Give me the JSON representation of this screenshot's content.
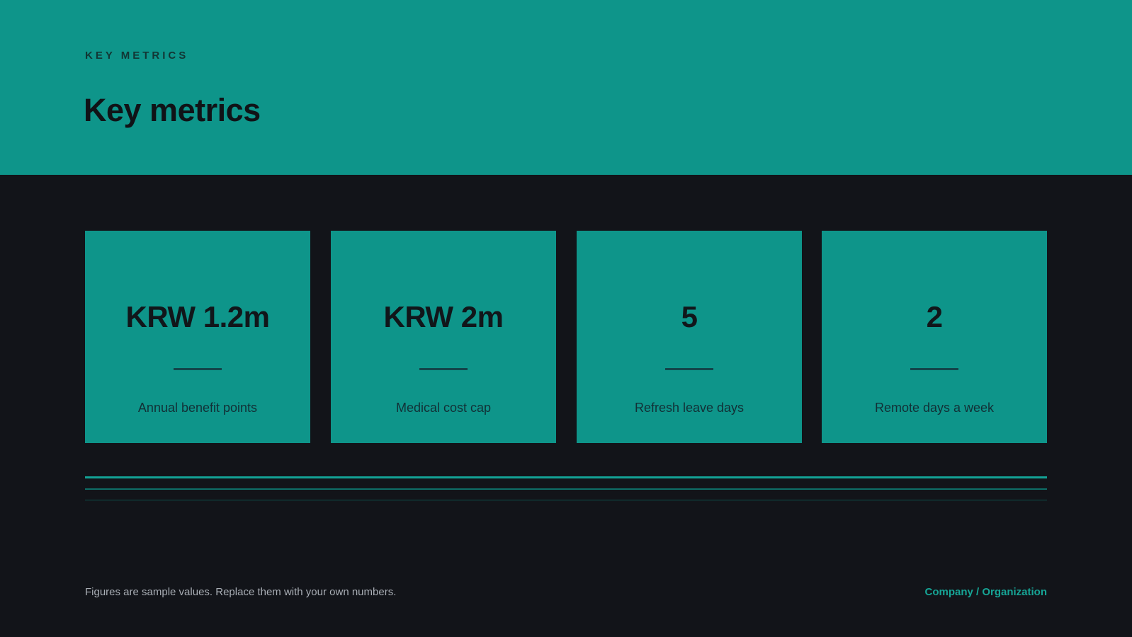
{
  "header": {
    "eyebrow": "KEY METRICS",
    "title": "Key metrics"
  },
  "metrics": [
    {
      "value": "KRW 1.2m",
      "label": "Annual benefit points"
    },
    {
      "value": "KRW 2m",
      "label": "Medical cost cap"
    },
    {
      "value": "5",
      "label": "Refresh leave days"
    },
    {
      "value": "2",
      "label": "Remote days a week"
    }
  ],
  "footer": {
    "note": "Figures are sample values. Replace them with your own numbers.",
    "organization": "Company / Organization"
  },
  "colors": {
    "accent": "#0e958a",
    "background": "#121419",
    "footer_link": "#16a596"
  }
}
